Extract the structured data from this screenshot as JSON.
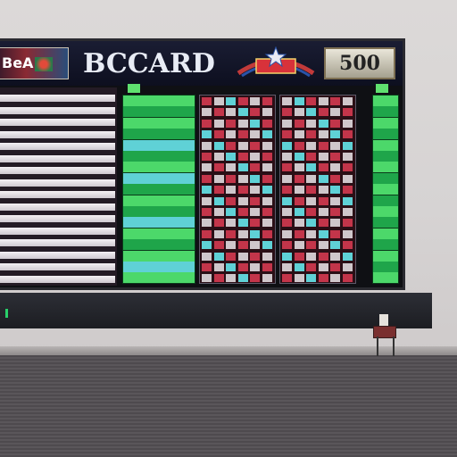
{
  "scene": "scoreboard-room",
  "board": {
    "logo_left_text": "BeA",
    "title": "BCCARD",
    "score_box_text": "500"
  },
  "left_panel": {
    "rows": 16,
    "row_tail_labels": [
      "",
      "",
      "",
      "",
      "",
      "",
      "",
      "",
      "",
      "",
      "",
      "",
      "",
      "",
      "",
      ""
    ]
  },
  "green_column": {
    "rows": 17,
    "labels": [
      "",
      "",
      "",
      "",
      "",
      "",
      "",
      "",
      "",
      "",
      "",
      "",
      "",
      "",
      "",
      "",
      ""
    ]
  },
  "red_columns": {
    "count": 2,
    "rows": 17
  },
  "colors": {
    "board_bg": "#0f1014",
    "header_bg": "#1a1d33",
    "green_bright": "#4cd86a",
    "green_dark": "#1fa54a",
    "cyan": "#5fd1d6",
    "red": "#c3354a",
    "grey_cell": "#cfc7cb"
  }
}
